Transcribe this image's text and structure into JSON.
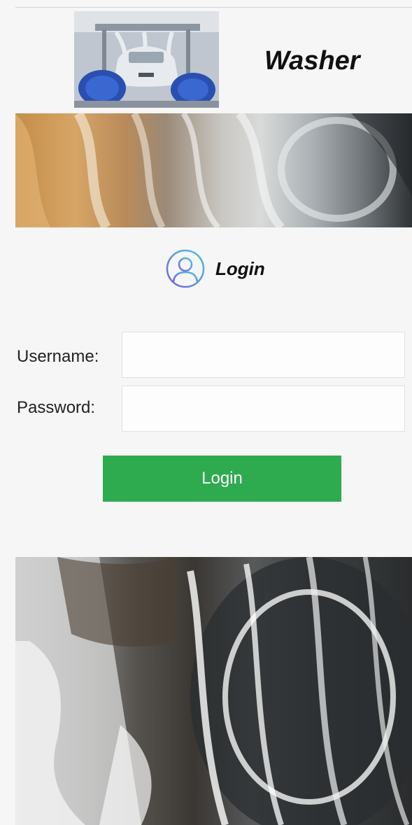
{
  "header": {
    "title": "Washer"
  },
  "login": {
    "heading": "Login",
    "username_label": "Username:",
    "password_label": "Password:",
    "username_value": "",
    "password_value": "",
    "submit_label": "Login"
  },
  "colors": {
    "accent": "#2eaa4f",
    "background": "#f6f6f6",
    "icon_stroke_start": "#7b5fd8",
    "icon_stroke_end": "#49c6e6"
  },
  "icons": {
    "user": "user-circle-icon"
  }
}
